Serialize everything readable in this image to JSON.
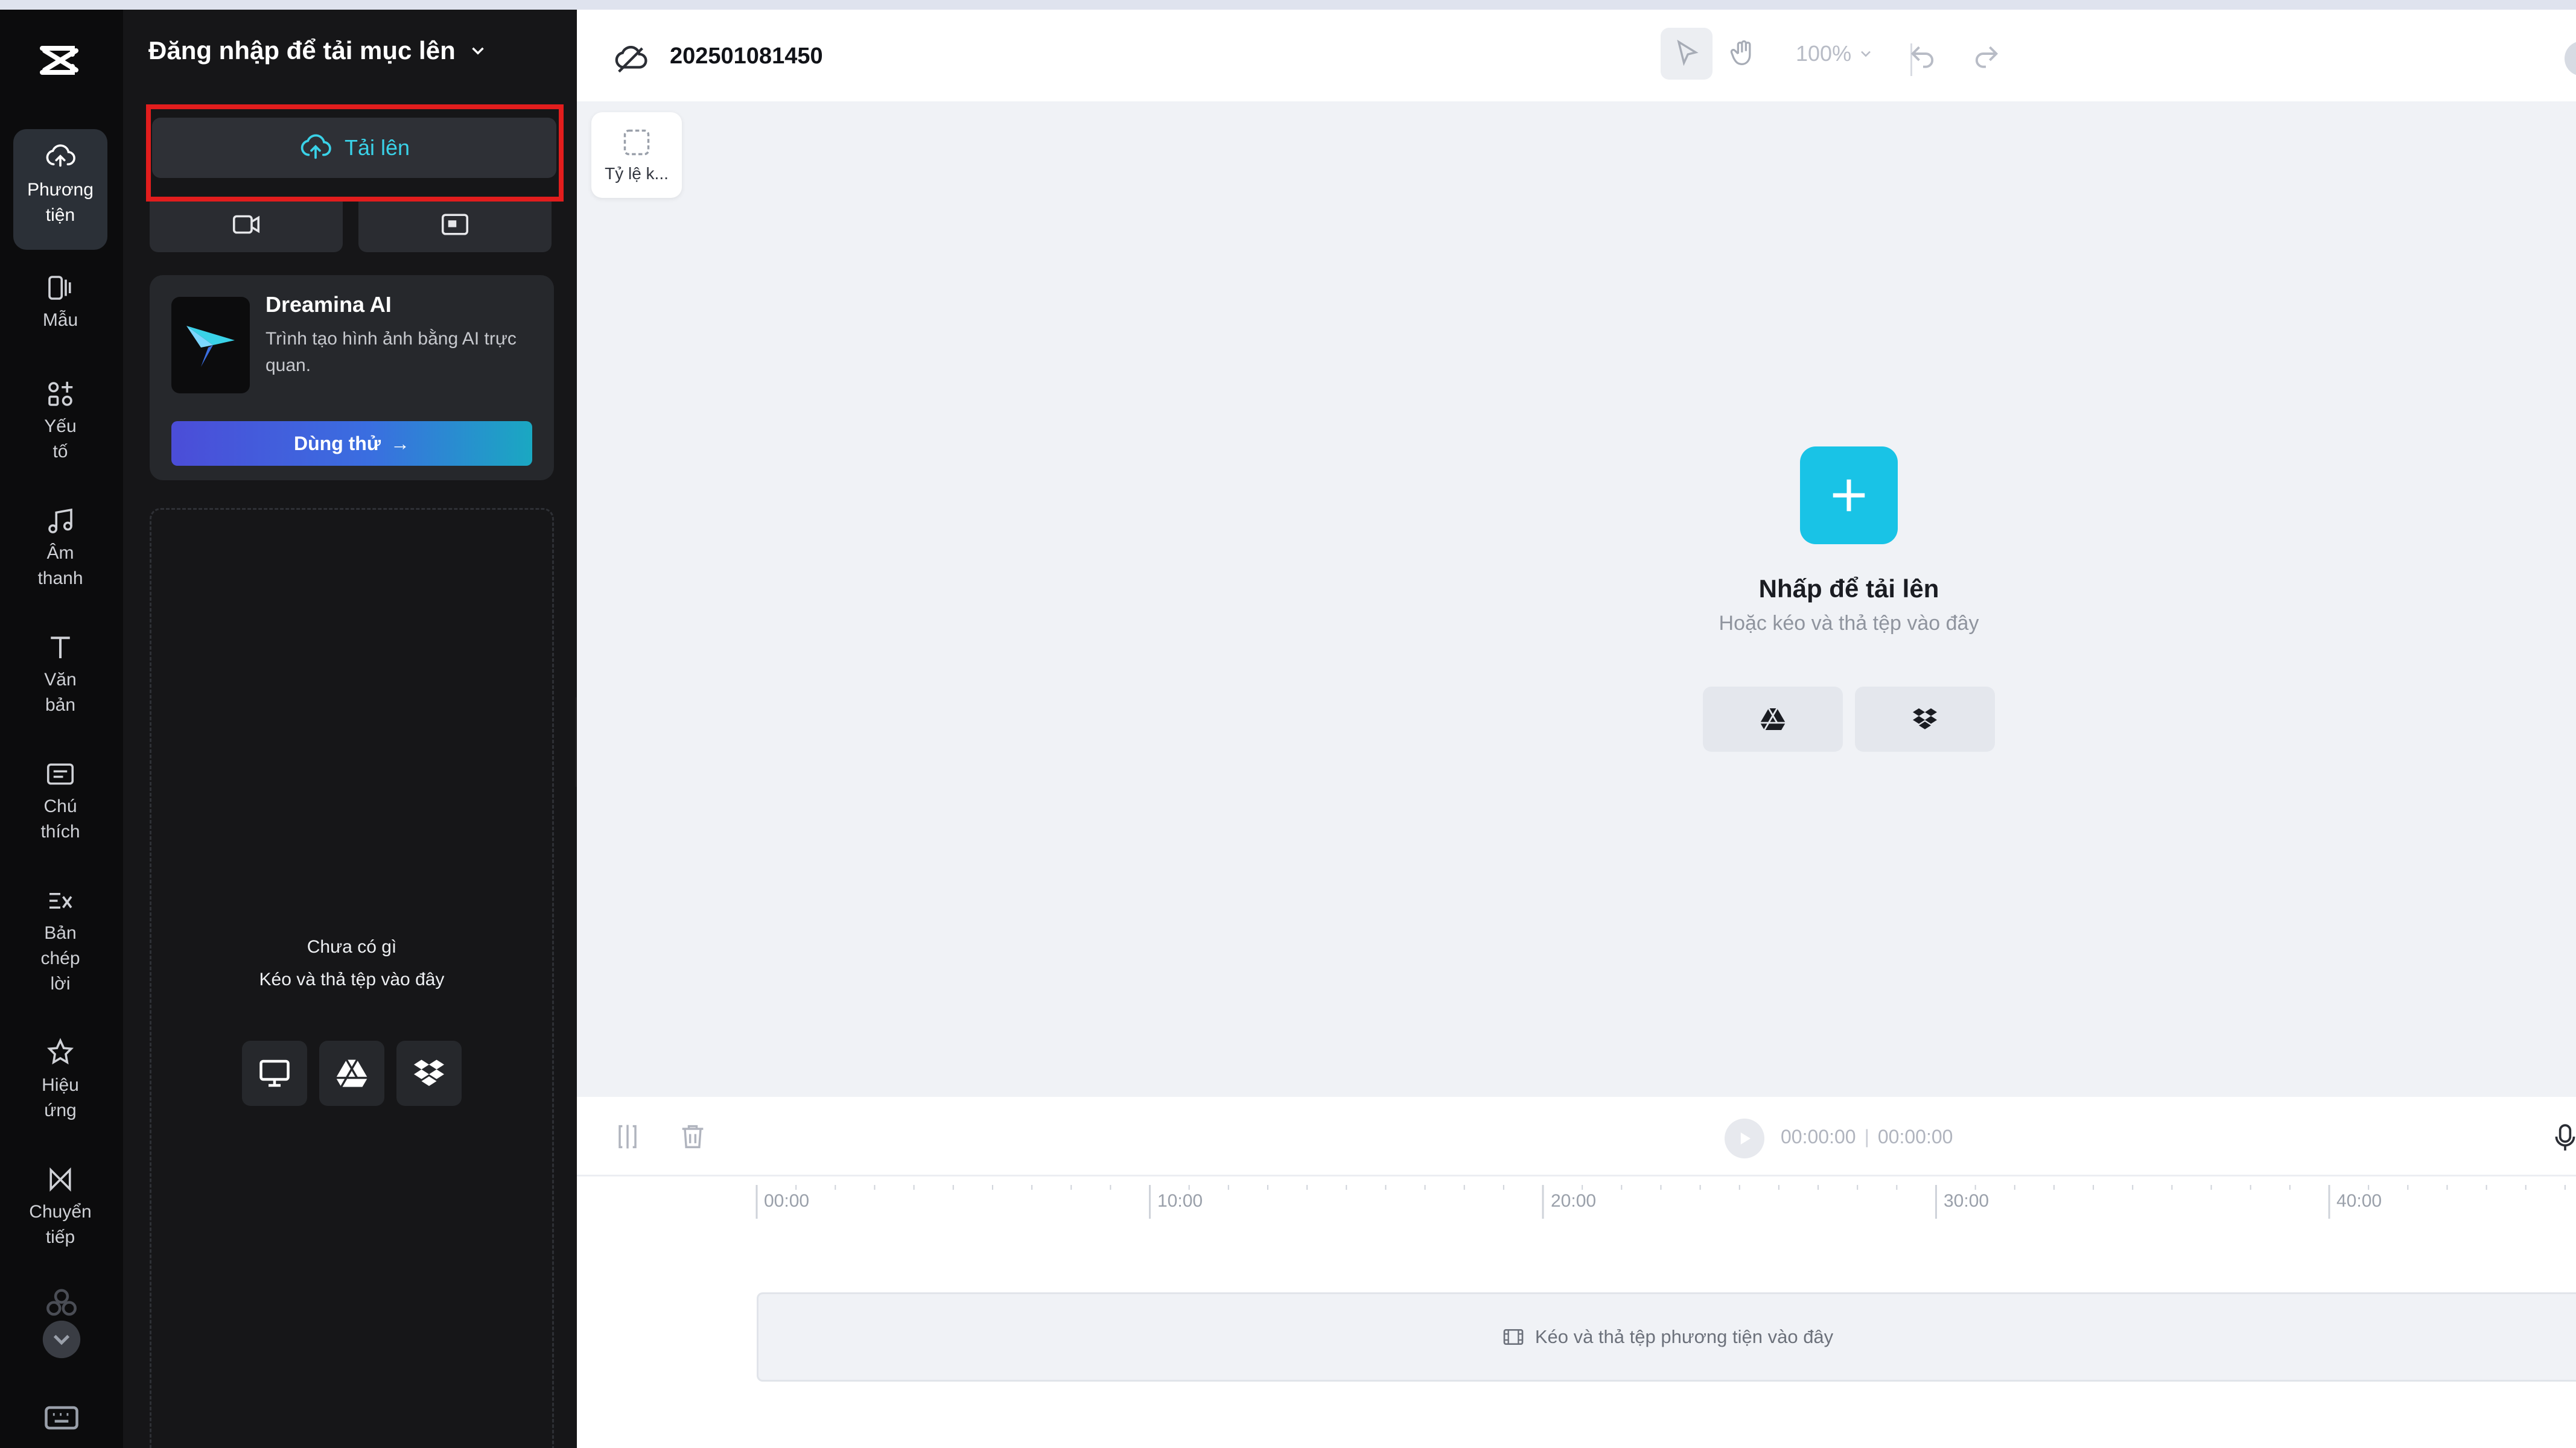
{
  "rail": {
    "items": [
      {
        "label": "Phương\ntiện",
        "icon": "cloud-upload-icon",
        "active": true
      },
      {
        "label": "Mẫu",
        "icon": "template-icon"
      },
      {
        "label": "Yếu\ntố",
        "icon": "elements-icon"
      },
      {
        "label": "Âm\nthanh",
        "icon": "music-note-icon"
      },
      {
        "label": "Văn\nbản",
        "icon": "text-icon"
      },
      {
        "label": "Chú\nthích",
        "icon": "captions-icon"
      },
      {
        "label": "Bản\nchép\nlời",
        "icon": "transcript-icon"
      },
      {
        "label": "Hiệu\nứng",
        "icon": "effects-icon"
      },
      {
        "label": "Chuyển\ntiếp",
        "icon": "transition-icon"
      }
    ]
  },
  "panel": {
    "title": "Đăng nhập để tải mục lên",
    "upload_label": "Tải lên",
    "promo": {
      "title": "Dreamina AI",
      "description": "Trình tạo hình ảnh bằng AI trực quan.",
      "button_label": "Dùng thử"
    },
    "empty": {
      "line1": "Chưa có gì",
      "line2": "Kéo và thả tệp vào đây"
    }
  },
  "topbar": {
    "project_title": "202501081450",
    "zoom": "100%"
  },
  "canvas": {
    "ratio_label": "Tỷ lệ k...",
    "title": "Nhấp để tải lên",
    "subtitle": "Hoặc kéo và thả tệp vào đây"
  },
  "timeline": {
    "current_time": "00:00:00",
    "total_time": "00:00:00",
    "ruler": [
      "00:00",
      "10:00",
      "20:00",
      "30:00",
      "40:00"
    ],
    "drop_hint": "Kéo và thả tệp phương tiện vào đây"
  },
  "colors": {
    "accent": "#19c3e6",
    "highlight": "#e21d1d",
    "panel_bg": "#161618"
  }
}
